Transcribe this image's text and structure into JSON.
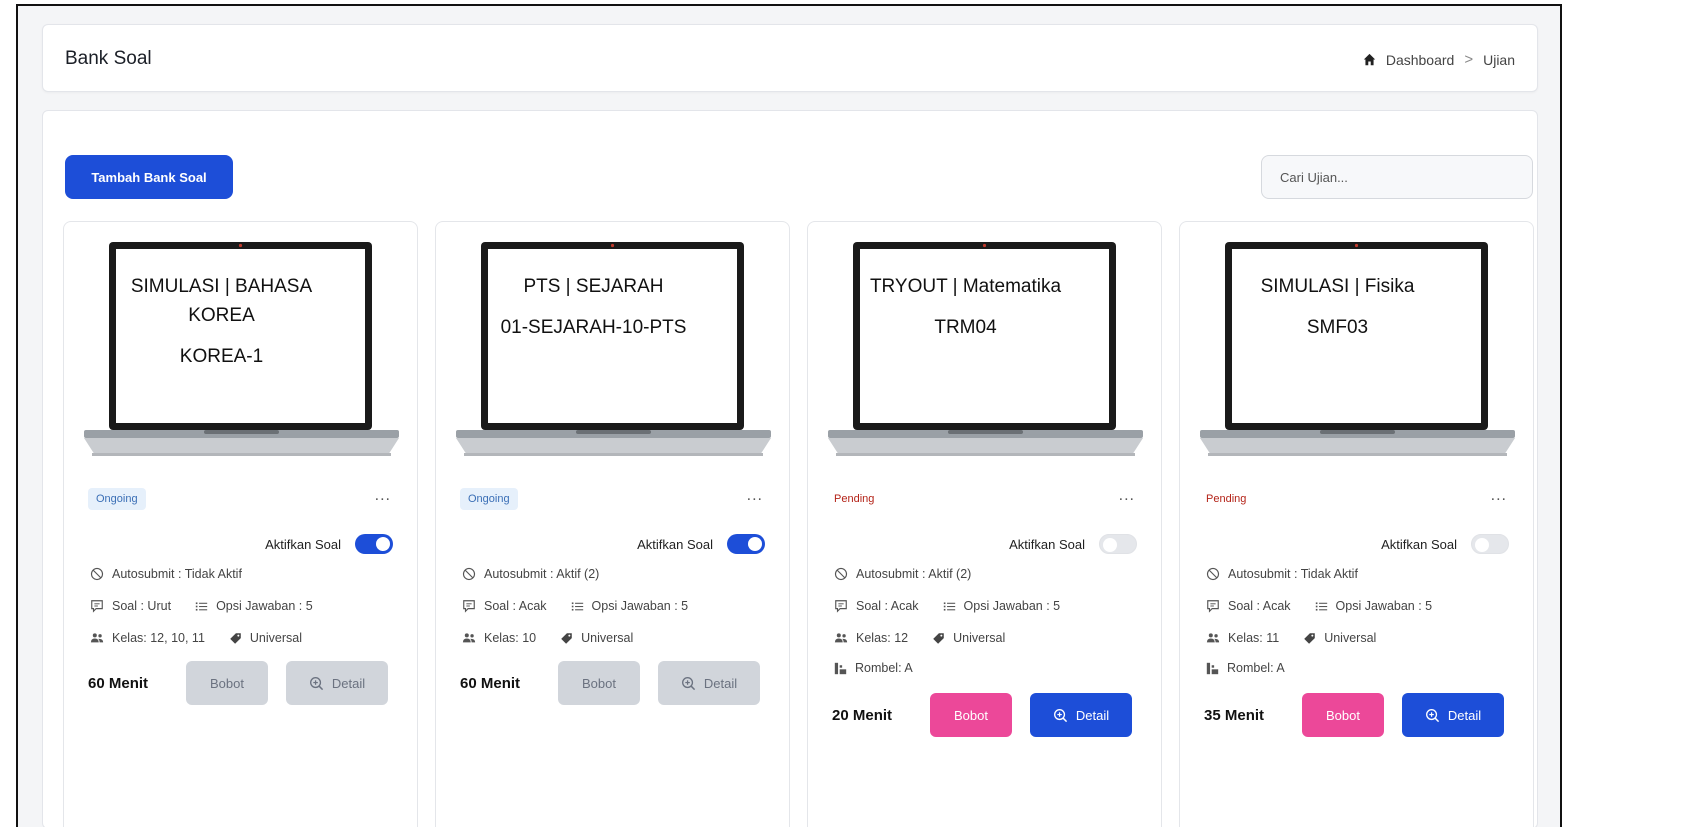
{
  "header": {
    "title": "Bank Soal",
    "breadcrumb": [
      "Dashboard",
      "Ujian"
    ],
    "breadcrumb_sep": ">"
  },
  "toolbar": {
    "add_label": "Tambah Bank Soal",
    "search_placeholder": "Cari Ujian..."
  },
  "colors": {
    "primary": "#1d4ed8",
    "pink": "#ec4899",
    "disabled": "#d1d5db",
    "ongoing_bg": "#e6f0fb",
    "ongoing_text": "#3b6fb6",
    "pending_text": "#b42318"
  },
  "icons": {
    "home": "home-icon",
    "autosubmit": "ban-icon",
    "soal": "message-icon",
    "opsi": "list-icon",
    "kelas": "users-icon",
    "universal": "tag-icon",
    "rombel": "group-icon",
    "detail": "zoom-in-icon",
    "more": "ellipsis-icon"
  },
  "cards": [
    {
      "screen_title": "SIMULASI | BAHASA KOREA",
      "screen_code": "KOREA-1",
      "status": "Ongoing",
      "status_kind": "ongoing",
      "more": "...",
      "toggle_label": "Aktifkan Soal",
      "toggle_on": true,
      "autosubmit": "Autosubmit : Tidak Aktif",
      "soal": "Soal : Urut",
      "opsi": "Opsi Jawaban : 5",
      "kelas": "Kelas: 12, 10, 11",
      "universal": "Universal",
      "rombel": "",
      "duration": "60 Menit",
      "bobot_label": "Bobot",
      "detail_label": "Detail",
      "buttons_active": false
    },
    {
      "screen_title": "PTS | SEJARAH",
      "screen_code": "01-SEJARAH-10-PTS",
      "status": "Ongoing",
      "status_kind": "ongoing",
      "more": "...",
      "toggle_label": "Aktifkan Soal",
      "toggle_on": true,
      "autosubmit": "Autosubmit : Aktif (2)",
      "soal": "Soal : Acak",
      "opsi": "Opsi Jawaban : 5",
      "kelas": "Kelas: 10",
      "universal": "Universal",
      "rombel": "",
      "duration": "60 Menit",
      "bobot_label": "Bobot",
      "detail_label": "Detail",
      "buttons_active": false
    },
    {
      "screen_title": "TRYOUT | Matematika",
      "screen_code": "TRM04",
      "status": "Pending",
      "status_kind": "pending",
      "more": "...",
      "toggle_label": "Aktifkan Soal",
      "toggle_on": false,
      "autosubmit": "Autosubmit : Aktif (2)",
      "soal": "Soal : Acak",
      "opsi": "Opsi Jawaban : 5",
      "kelas": "Kelas: 12",
      "universal": "Universal",
      "rombel": "Rombel: A",
      "duration": "20 Menit",
      "bobot_label": "Bobot",
      "detail_label": "Detail",
      "buttons_active": true
    },
    {
      "screen_title": "SIMULASI | Fisika",
      "screen_code": "SMF03",
      "status": "Pending",
      "status_kind": "pending",
      "more": "...",
      "toggle_label": "Aktifkan Soal",
      "toggle_on": false,
      "autosubmit": "Autosubmit : Tidak Aktif",
      "soal": "Soal : Acak",
      "opsi": "Opsi Jawaban : 5",
      "kelas": "Kelas: 11",
      "universal": "Universal",
      "rombel": "Rombel: A",
      "duration": "35 Menit",
      "bobot_label": "Bobot",
      "detail_label": "Detail",
      "buttons_active": true
    }
  ]
}
